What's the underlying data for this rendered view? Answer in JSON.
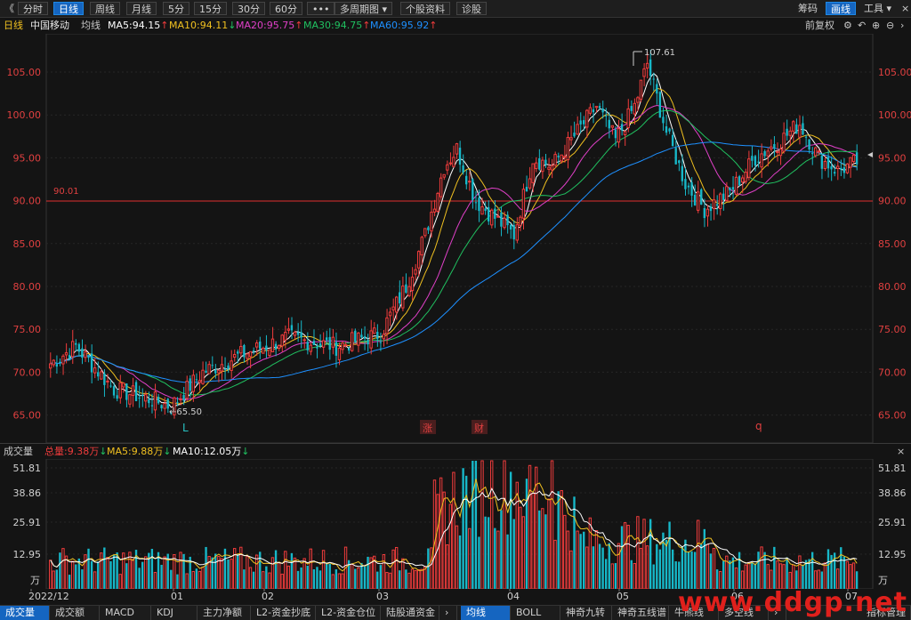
{
  "topbar": {
    "back_glyph": "《",
    "buttons": [
      {
        "label": "分时"
      },
      {
        "label": "日线",
        "active": true
      },
      {
        "label": "周线"
      },
      {
        "label": "月线"
      },
      {
        "label": "5分"
      },
      {
        "label": "15分"
      },
      {
        "label": "30分"
      },
      {
        "label": "60分"
      },
      {
        "label": "•••"
      },
      {
        "label": "多周期图 ▾"
      },
      {
        "label": "个股资料"
      },
      {
        "label": "诊股"
      }
    ],
    "right": [
      {
        "label": "筹码"
      },
      {
        "label": "画线",
        "active": true
      },
      {
        "label": "工具 ▾"
      }
    ]
  },
  "indicators": {
    "period": "日线",
    "name": "中国移动",
    "label": "均线",
    "ma5": "MA5:94.15",
    "ma10": "MA10:94.11",
    "ma20": "MA20:95.75",
    "ma30": "MA30:94.75",
    "ma60": "MA60:95.92",
    "adjust": "前复权"
  },
  "price_axis": {
    "ticks": [
      "105.00",
      "100.00",
      "95.00",
      "90.00",
      "85.00",
      "80.00",
      "75.00",
      "70.00",
      "65.00"
    ]
  },
  "annotations": {
    "hline_value": "90.01",
    "high": "107.61",
    "low": "65.50",
    "markers": [
      {
        "text": "L",
        "color": "#27c2c2"
      },
      {
        "text": "涨",
        "color": "#e04040"
      },
      {
        "text": "财",
        "color": "#e04040"
      },
      {
        "text": "q",
        "color": "#e04040"
      }
    ]
  },
  "volume": {
    "title": "成交量",
    "total": "总量:9.38万",
    "ma5": "MA5:9.88万",
    "ma10": "MA10:12.05万",
    "ticks": [
      "51.81",
      "38.86",
      "25.91",
      "12.95"
    ],
    "unit": "万"
  },
  "xaxis": {
    "labels": [
      "2022/12",
      "01",
      "02",
      "03",
      "04",
      "05",
      "06",
      "07"
    ]
  },
  "bottom": {
    "left_tabs": [
      {
        "label": "成交量",
        "active": true
      },
      {
        "label": "成交额"
      },
      {
        "label": "MACD"
      },
      {
        "label": "KDJ"
      },
      {
        "label": "主力净额"
      },
      {
        "label": "L2-资金抄底"
      },
      {
        "label": "L2-资金仓位"
      },
      {
        "label": "陆股通资金"
      }
    ],
    "right_tabs": [
      {
        "label": "均线",
        "active": true
      },
      {
        "label": "BOLL"
      },
      {
        "label": "神奇九转"
      },
      {
        "label": "神奇五线谱"
      },
      {
        "label": "牛熊线"
      },
      {
        "label": "多空线"
      }
    ],
    "manage": "指标管理"
  },
  "watermark": "www.ddgp.net",
  "colors": {
    "up": "#f03c3c",
    "down": "#17b8c9",
    "ma5": "#ffffff",
    "ma10": "#f0c020",
    "ma20": "#e040c8",
    "ma30": "#20c060",
    "ma60": "#1e90ff"
  }
}
